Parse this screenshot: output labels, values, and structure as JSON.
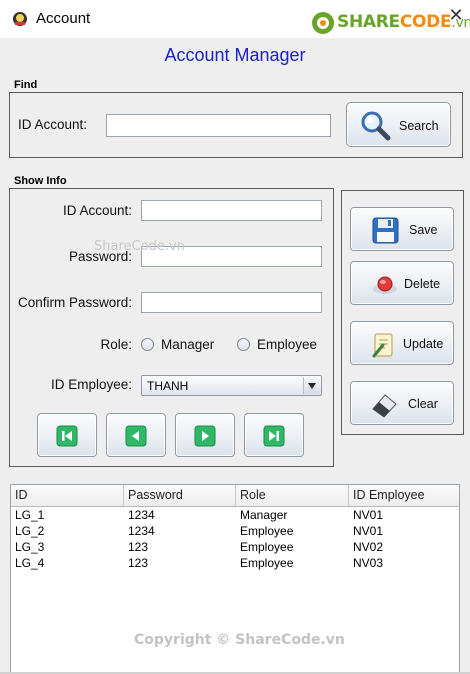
{
  "window": {
    "title": "Account"
  },
  "brand": {
    "part1": "SHARE",
    "part2": "CODE",
    "part3": ".vn"
  },
  "header": {
    "title": "Account Manager"
  },
  "find": {
    "group_title": "Find",
    "id_label": "ID Account:",
    "id_value": "",
    "search_label": "Search"
  },
  "info": {
    "group_title": "Show Info",
    "id_label": "ID Account:",
    "password_label": "Password:",
    "confirm_label": "Confirm Password:",
    "role_label": "Role:",
    "role_options": [
      "Manager",
      "Employee"
    ],
    "employee_label": "ID Employee:",
    "employee_value": "THANH"
  },
  "actions": {
    "save": "Save",
    "delete": "Delete",
    "update": "Update",
    "clear": "Clear"
  },
  "table": {
    "columns": [
      "ID",
      "Password",
      "Role",
      "ID Employee"
    ],
    "rows": [
      [
        "LG_1",
        "1234",
        "Manager",
        "NV01"
      ],
      [
        "LG_2",
        "1234",
        "Employee",
        "NV01"
      ],
      [
        "LG_3",
        "123",
        "Employee",
        "NV02"
      ],
      [
        "LG_4",
        "123",
        "Employee",
        "NV03"
      ]
    ]
  },
  "watermarks": {
    "center": "ShareCode.vn",
    "bottom": "Copyright © ShareCode.vn"
  },
  "colors": {
    "heading": "#1b22c6",
    "nav_green": "#2fb866",
    "brand_green": "#6aa329",
    "brand_orange": "#f28b12"
  }
}
